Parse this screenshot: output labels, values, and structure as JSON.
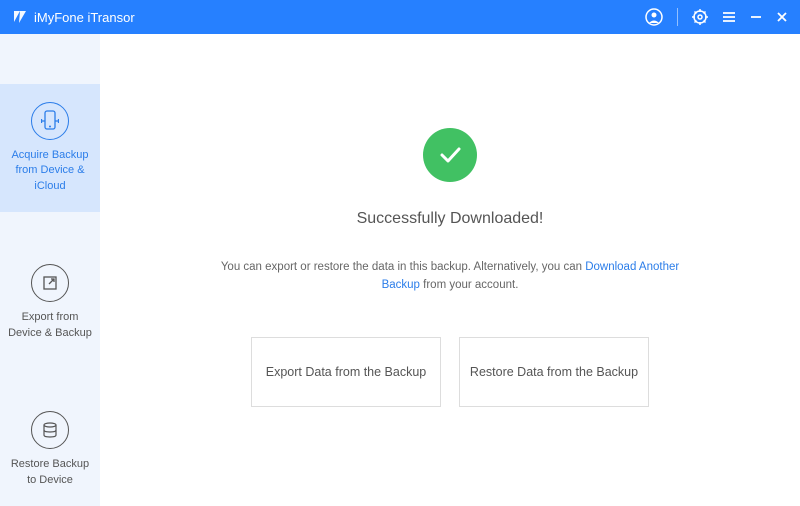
{
  "header": {
    "app_name": "iMyFone iTransor"
  },
  "sidebar": {
    "items": [
      {
        "label": "Acquire Backup from Device & iCloud"
      },
      {
        "label": "Export from Device & Backup"
      },
      {
        "label": "Restore Backup to Device"
      }
    ]
  },
  "content": {
    "title": "Successfully Downloaded!",
    "text_before": "You can export or restore the data in this backup. Alternatively, you can ",
    "link_text": "Download Another Backup",
    "text_after": " from your account.",
    "button1": "Export Data from the Backup",
    "button2": "Restore Data from the Backup"
  },
  "colors": {
    "primary": "#2680ff",
    "sidebar_bg": "#f0f5fd",
    "sidebar_active": "#d6e6fd",
    "success": "#41c163"
  }
}
